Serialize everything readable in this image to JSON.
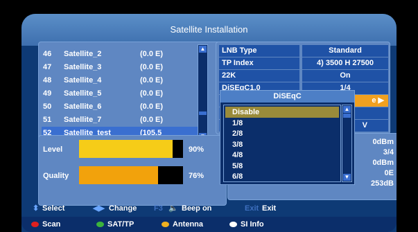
{
  "title": "Satellite Installation",
  "satellites": [
    {
      "num": "46",
      "name": "Satellite_2",
      "val": "(0.0 E)"
    },
    {
      "num": "47",
      "name": "Satellite_3",
      "val": "(0.0 E)"
    },
    {
      "num": "48",
      "name": "Satellite_4",
      "val": "(0.0 E)"
    },
    {
      "num": "49",
      "name": "Satellite_5",
      "val": "(0.0 E)"
    },
    {
      "num": "50",
      "name": "Satellite_6",
      "val": "(0.0 E)"
    },
    {
      "num": "51",
      "name": "Satellite_7",
      "val": "(0.0 E)"
    },
    {
      "num": "52",
      "name": "Satellite_test",
      "val": "(105.5"
    }
  ],
  "params": [
    {
      "label": "LNB Type",
      "value": "Standard"
    },
    {
      "label": "TP Index",
      "value": "4) 3500 H 27500"
    },
    {
      "label": "22K",
      "value": "On"
    },
    {
      "label": "DiSEqC1.0",
      "value": "1/4"
    },
    {
      "label": "",
      "value": "e ▶"
    },
    {
      "label": "",
      "value": ""
    },
    {
      "label": "",
      "value": "V"
    }
  ],
  "signal": {
    "level_label": "Level",
    "level_pct_text": "90%",
    "level_fraction": 0.9,
    "quality_label": "Quality",
    "quality_pct_text": "76%",
    "quality_fraction": 0.76,
    "level_color": "#f6cc18",
    "quality_color": "#f2a20c"
  },
  "right_values": [
    "0dBm",
    "3/4",
    "0dBm",
    "0E",
    "253dB"
  ],
  "popup": {
    "title": "DiSEqC",
    "options": [
      "Disable",
      "1/8",
      "2/8",
      "3/8",
      "4/8",
      "5/8",
      "6/8"
    ],
    "selected_index": 0
  },
  "help": {
    "select": "Select",
    "change": "Change",
    "f3": "F3",
    "beep": "Beep on",
    "exit_key": "Exit",
    "exit": "Exit"
  },
  "colors_bar": {
    "scan": "Scan",
    "sattp": "SAT/TP",
    "antenna": "Antenna",
    "siinfo": "SI Info"
  }
}
